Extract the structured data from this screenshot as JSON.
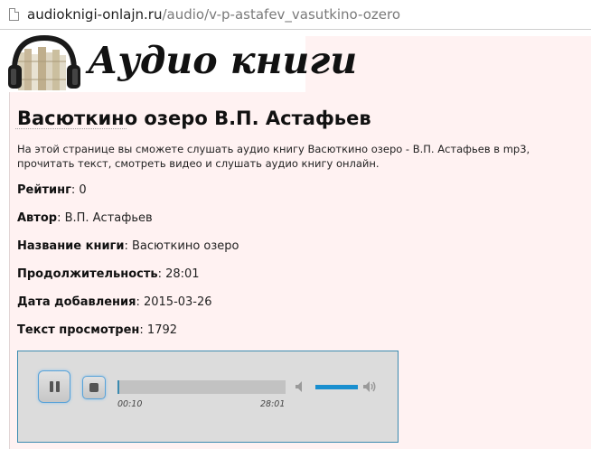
{
  "browser": {
    "url_domain": "audioknigi-onlajn.ru",
    "url_path": "/audio/v-p-astafev_vasutkino-ozero"
  },
  "header": {
    "logo_text": "Аудио книги",
    "logo_icon": "headphones-books-icon"
  },
  "page": {
    "title": "Васюткино озеро В.П. Астафьев",
    "description": "На этой странице вы сможете слушать аудио книгу Васюткино озеро - В.П. Астафьев в mp3, прочитать текст, смотреть видео и слушать аудио книгу онлайн."
  },
  "fields": [
    {
      "label": "Рейтинг",
      "value": "0"
    },
    {
      "label": "Автор",
      "value": "В.П. Астафьев"
    },
    {
      "label": "Название книги",
      "value": "Васюткино озеро"
    },
    {
      "label": "Продолжительность",
      "value": "28:01"
    },
    {
      "label": "Дата добавления",
      "value": "2015-03-26"
    },
    {
      "label": "Текст просмотрен",
      "value": "1792"
    }
  ],
  "player": {
    "current_time": "00:10",
    "duration": "28:01",
    "progress_fraction": 0.006,
    "volume_fraction": 1.0,
    "accent_color": "#3b8bb0",
    "pause_icon": "pause-icon",
    "stop_icon": "stop-icon",
    "mute_icon": "speaker-mute-icon",
    "volume_icon": "speaker-volume-icon"
  }
}
